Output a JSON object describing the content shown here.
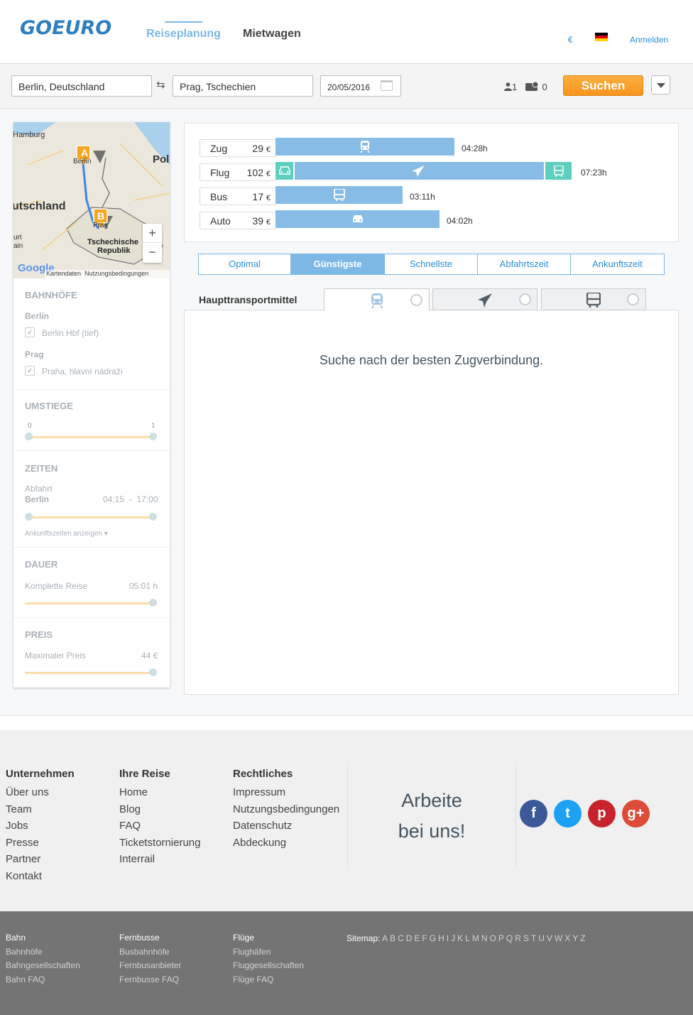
{
  "header": {
    "logo": "GOEURO",
    "nav": {
      "plan": "Reiseplanung",
      "car": "Mietwagen"
    },
    "currency": "€",
    "login": "Anmelden"
  },
  "search": {
    "from": "Berlin, Deutschland",
    "to": "Prag, Tschechien",
    "date": "20/05/2016",
    "adults": "1",
    "discounts": "0",
    "button": "Suchen"
  },
  "map": {
    "labels": {
      "hamburg": "Hamburg",
      "pol": "Pol",
      "deutschland": "utschland",
      "berlin": "Berlin",
      "prag": "Prag",
      "czech1": "Tschechische",
      "czech2": "Republik",
      "burt": "urt",
      "ain": "ain"
    },
    "marker_a": "A",
    "marker_b": "B",
    "zoom_in": "+",
    "zoom_out": "−",
    "google": "Google",
    "mapdata": "Kartendaten",
    "terms": "Nutzungsbedingungen"
  },
  "filters": {
    "stations": {
      "title": "BAHNHÖFE",
      "from_city": "Berlin",
      "from_station": "Berlin Hbf (tief)",
      "to_city": "Prag",
      "to_station": "Praha, hlavní nádraží"
    },
    "transfers": {
      "title": "UMSTIEGE",
      "min": "0",
      "max": "1"
    },
    "times": {
      "title": "ZEITEN",
      "label": "Abfahrt",
      "city": "Berlin",
      "range": "04:15  -  17:00",
      "toggle": "Ankunftszeiten anzeigen"
    },
    "duration": {
      "title": "DAUER",
      "label": "Komplette Reise",
      "value": "05:01 h"
    },
    "price": {
      "title": "PREIS",
      "label": "Maximaler Preis",
      "value": "44 €"
    }
  },
  "modes": [
    {
      "name": "Zug",
      "price": "29",
      "currency": "€",
      "duration": "04:28h"
    },
    {
      "name": "Flug",
      "price": "102",
      "currency": "€",
      "duration": "07:23h"
    },
    {
      "name": "Bus",
      "price": "17",
      "currency": "€",
      "duration": "03:11h"
    },
    {
      "name": "Auto",
      "price": "39",
      "currency": "€",
      "duration": "04:02h"
    }
  ],
  "sort_tabs": [
    "Optimal",
    "Günstigste",
    "Schnellste",
    "Abfahrtszeit",
    "Ankunftszeit"
  ],
  "main_transport_label": "Haupttransportmittel",
  "status_message": "Suche nach der besten Zugverbindung.",
  "footer": {
    "col1": {
      "title": "Unternehmen",
      "links": [
        "Über uns",
        "Team",
        "Jobs",
        "Presse",
        "Partner",
        "Kontakt"
      ]
    },
    "col2": {
      "title": "Ihre Reise",
      "links": [
        "Home",
        "Blog",
        "FAQ",
        "Ticketstornierung",
        "Interrail"
      ]
    },
    "col3": {
      "title": "Rechtliches",
      "links": [
        "Impressum",
        "Nutzungsbedingungen",
        "Datenschutz",
        "Abdeckung"
      ]
    },
    "work": {
      "line1": "Arbeite",
      "line2": "bei uns!"
    },
    "social": {
      "facebook": "f",
      "twitter": "t",
      "pinterest": "p",
      "google": "g+"
    }
  },
  "footer2": {
    "bahn": {
      "title": "Bahn",
      "links": [
        "Bahnhöfe",
        "Bahngesellschaften",
        "Bahn FAQ"
      ]
    },
    "bus": {
      "title": "Fernbusse",
      "links": [
        "Busbahnhöfe",
        "Fernbusanbieter",
        "Fernbusse FAQ"
      ]
    },
    "flight": {
      "title": "Flüge",
      "links": [
        "Flughäfen",
        "Fluggesellschaften",
        "Flüge FAQ"
      ]
    },
    "sitemap_label": "Sitemap:",
    "letters": [
      "A",
      "B",
      "C",
      "D",
      "E",
      "F",
      "G",
      "H",
      "I",
      "J",
      "K",
      "L",
      "M",
      "N",
      "O",
      "P",
      "Q",
      "R",
      "S",
      "T",
      "U",
      "V",
      "W",
      "X",
      "Y",
      "Z"
    ]
  }
}
